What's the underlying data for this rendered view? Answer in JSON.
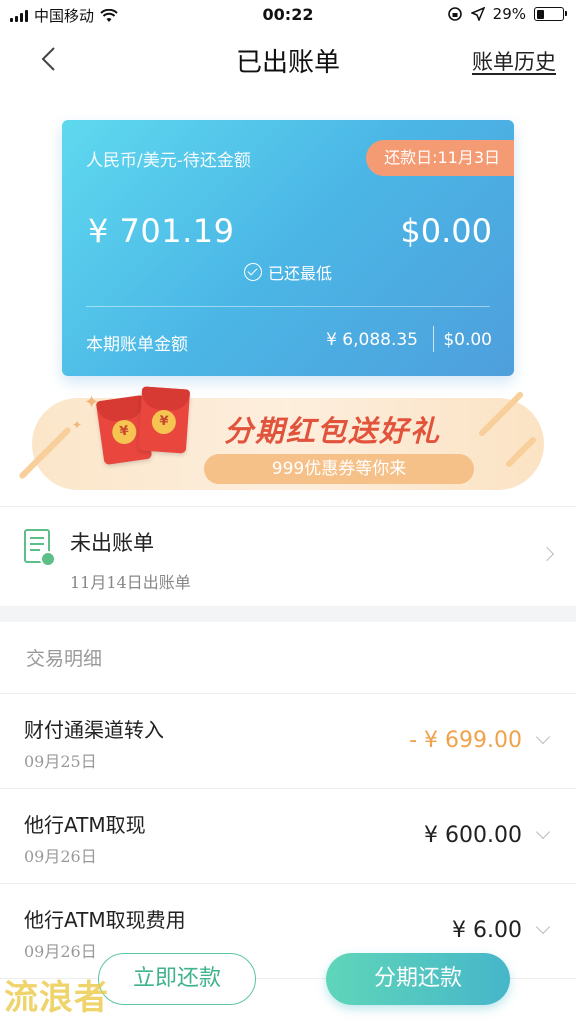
{
  "status_bar": {
    "carrier": "中国移动",
    "time": "00:22",
    "battery": "29%"
  },
  "nav": {
    "title": "已出账单",
    "history_link": "账单历史"
  },
  "bill_card": {
    "currency_label": "人民币/美元-待还金额",
    "due_date_badge": "还款日:11月3日",
    "amount_cny": "¥ 701.19",
    "amount_usd": "$0.00",
    "paid_status": "已还最低",
    "period_label": "本期账单金额",
    "period_cny": "¥ 6,088.35",
    "period_usd": "$0.00"
  },
  "promo": {
    "title": "分期红包送好礼",
    "subtitle": "999优惠券等你来",
    "coin_symbol": "¥"
  },
  "unbilled": {
    "title": "未出账单",
    "date": "11月14日出账单"
  },
  "transactions": {
    "header": "交易明细",
    "items": [
      {
        "name": "财付通渠道转入",
        "date": "09月25日",
        "amount": "- ¥ 699.00"
      },
      {
        "name": "他行ATM取现",
        "date": "09月26日",
        "amount": "¥ 600.00"
      },
      {
        "name": "他行ATM取现费用",
        "date": "09月26日",
        "amount": "¥ 6.00"
      }
    ]
  },
  "actions": {
    "pay_now": "立即还款",
    "installment": "分期还款"
  },
  "watermark": "流浪者",
  "colors": {
    "accent_green": "#5cc6a0",
    "card_blue": "#4bb6e6",
    "badge_orange": "#f59b74",
    "negative_amount": "#f1a24a"
  }
}
